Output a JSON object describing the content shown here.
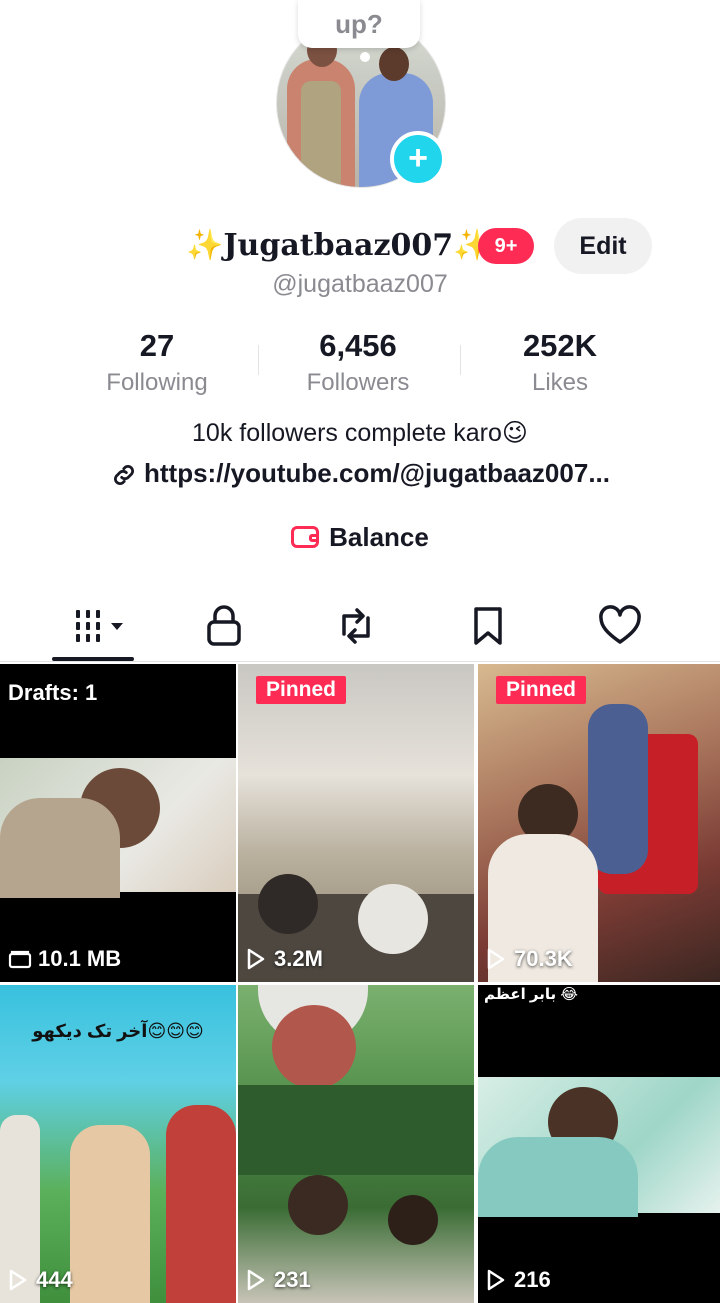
{
  "bubble": {
    "text": "up?"
  },
  "profile": {
    "display_name": "✨Jugatbaaz007✨",
    "notification_badge": "9+",
    "edit_label": "Edit",
    "handle": "@jugatbaaz007"
  },
  "stats": [
    {
      "value": "27",
      "label": "Following"
    },
    {
      "value": "6,456",
      "label": "Followers"
    },
    {
      "value": "252K",
      "label": "Likes"
    }
  ],
  "bio": "10k followers complete karo😉",
  "link": "https://youtube.com/@jugatbaaz007...",
  "balance_label": "Balance",
  "tabs": [
    {
      "icon": "grid-icon",
      "active": true
    },
    {
      "icon": "lock-icon"
    },
    {
      "icon": "repost-icon"
    },
    {
      "icon": "bookmark-icon"
    },
    {
      "icon": "heart-icon"
    }
  ],
  "videos": [
    {
      "top_label": "Drafts: 1",
      "bottom_label": "10.1 MB"
    },
    {
      "badge": "Pinned",
      "bottom_label": "3.2M"
    },
    {
      "badge": "Pinned",
      "bottom_label": "70.3K"
    },
    {
      "caption": "آخر تک دیکھو😊😊😊",
      "bottom_label": "444"
    },
    {
      "bottom_label": "231"
    },
    {
      "caption": "بابر اعظم 😂",
      "bottom_label": "216"
    }
  ],
  "colors": {
    "accent": "#fe2c55",
    "add_button": "#20d5ec",
    "text_primary": "#161823",
    "text_secondary": "#8a8b91"
  }
}
